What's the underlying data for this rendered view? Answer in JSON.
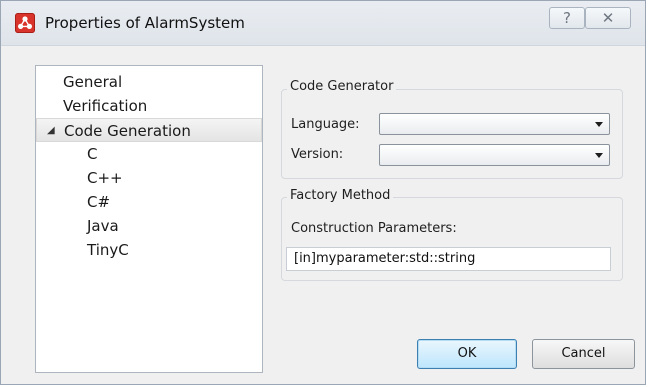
{
  "window": {
    "title": "Properties of AlarmSystem",
    "app_icon": "app-logo-icon",
    "help_glyph": "?",
    "close_glyph": "✕"
  },
  "tree": {
    "items": [
      {
        "label": "General",
        "level": 0
      },
      {
        "label": "Verification",
        "level": 0
      },
      {
        "label": "Code Generation",
        "level": 0,
        "expanded": true,
        "selected": true
      },
      {
        "label": "C",
        "level": 1
      },
      {
        "label": "C++",
        "level": 1
      },
      {
        "label": "C#",
        "level": 1
      },
      {
        "label": "Java",
        "level": 1
      },
      {
        "label": "TinyC",
        "level": 1
      }
    ],
    "expander_glyph": "◢"
  },
  "code_generator": {
    "group_title": "Code Generator",
    "language_label": "Language:",
    "language_value": "",
    "version_label": "Version:",
    "version_value": ""
  },
  "factory_method": {
    "group_title": "Factory Method",
    "params_label": "Construction Parameters:",
    "params_value": "[in]myparameter:std::string"
  },
  "buttons": {
    "ok": "OK",
    "cancel": "Cancel"
  },
  "colors": {
    "accent": "#3c7fb1",
    "app_icon": "#d9342b"
  }
}
